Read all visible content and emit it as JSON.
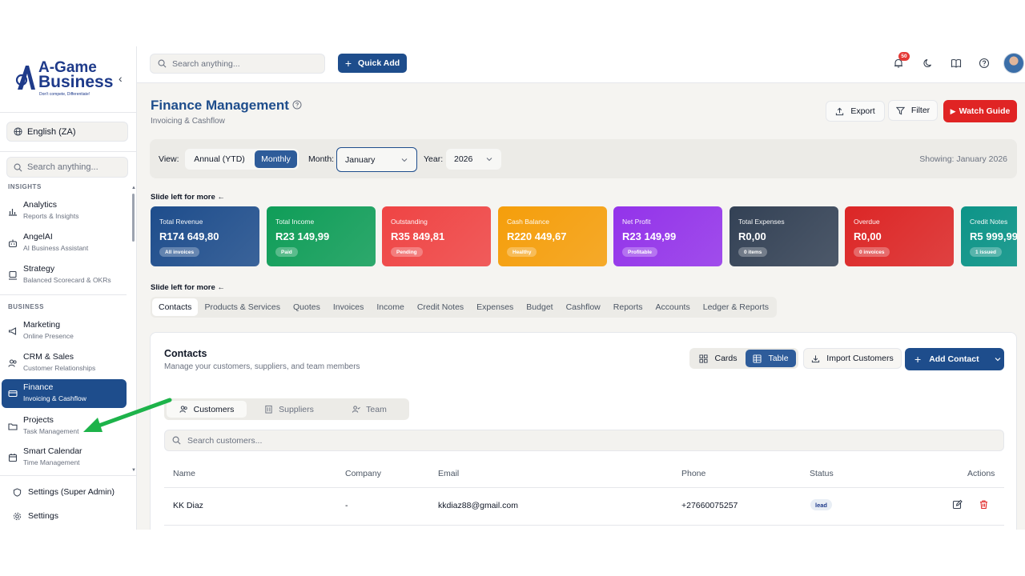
{
  "brand": {
    "line1": "A-Game",
    "line2": "Business",
    "tagline": "Don't compete, Differentiate!"
  },
  "sidebar": {
    "language": "English (ZA)",
    "search_placeholder": "Search anything...",
    "section_insights": "INSIGHTS",
    "section_business": "BUSINESS",
    "items": [
      {
        "title": "Analytics",
        "subtitle": "Reports & Insights",
        "icon": "bar-chart-icon"
      },
      {
        "title": "AngelAI",
        "subtitle": "AI Business Assistant",
        "icon": "robot-icon"
      },
      {
        "title": "Strategy",
        "subtitle": "Balanced Scorecard & OKRs",
        "icon": "strategy-icon"
      },
      {
        "title": "Marketing",
        "subtitle": "Online Presence",
        "icon": "megaphone-icon"
      },
      {
        "title": "CRM & Sales",
        "subtitle": "Customer Relationships",
        "icon": "users-icon"
      },
      {
        "title": "Finance",
        "subtitle": "Invoicing & Cashflow",
        "icon": "credit-card-icon"
      },
      {
        "title": "Projects",
        "subtitle": "Task Management",
        "icon": "folder-icon"
      },
      {
        "title": "Smart Calendar",
        "subtitle": "Time Management",
        "icon": "calendar-icon"
      }
    ],
    "bottom": [
      {
        "label": "Settings (Super Admin)",
        "icon": "shield-icon"
      },
      {
        "label": "Settings",
        "icon": "gear-icon"
      }
    ]
  },
  "topbar": {
    "search_placeholder": "Search anything...",
    "quick_add": "Quick Add",
    "notification_count": "50"
  },
  "page": {
    "title": "Finance Management",
    "subtitle": "Invoicing & Cashflow",
    "export": "Export",
    "filter": "Filter",
    "watch_guide": "Watch Guide"
  },
  "filters": {
    "view_label": "View:",
    "view_options": [
      "Annual (YTD)",
      "Monthly"
    ],
    "view_selected": "Monthly",
    "month_label": "Month:",
    "month": "January",
    "year_label": "Year:",
    "year": "2026",
    "showing": "Showing: January 2026"
  },
  "slide_hint": "Slide left for more ←",
  "cards": [
    {
      "label": "Total Revenue",
      "value": "R174 649,80",
      "pill": "All invoices",
      "color": "#1e4d8c"
    },
    {
      "label": "Total Income",
      "value": "R23 149,99",
      "pill": "Paid",
      "color": "#0f9d58"
    },
    {
      "label": "Outstanding",
      "value": "R35 849,81",
      "pill": "Pending",
      "color": "#ef4444"
    },
    {
      "label": "Cash Balance",
      "value": "R220 449,67",
      "pill": "Healthy",
      "color": "#f59e0b"
    },
    {
      "label": "Net Profit",
      "value": "R23 149,99",
      "pill": "Profitable",
      "color": "#9333ea"
    },
    {
      "label": "Total Expenses",
      "value": "R0,00",
      "pill": "0 items",
      "color": "#334155"
    },
    {
      "label": "Overdue",
      "value": "R0,00",
      "pill": "0 invoices",
      "color": "#dc2626"
    },
    {
      "label": "Credit Notes",
      "value": "R5 999,99",
      "pill": "1 issued",
      "color": "#0d9488"
    }
  ],
  "tabs": [
    "Contacts",
    "Products & Services",
    "Quotes",
    "Invoices",
    "Income",
    "Credit Notes",
    "Expenses",
    "Budget",
    "Cashflow",
    "Reports",
    "Accounts",
    "Ledger & Reports"
  ],
  "contacts": {
    "title": "Contacts",
    "subtitle": "Manage your customers, suppliers, and team members",
    "view_cards": "Cards",
    "view_table": "Table",
    "import": "Import Customers",
    "add": "Add Contact",
    "subtabs": [
      "Customers",
      "Suppliers",
      "Team"
    ],
    "search_placeholder": "Search customers...",
    "columns": [
      "Name",
      "Company",
      "Email",
      "Phone",
      "Status",
      "Actions"
    ],
    "rows": [
      {
        "name": "KK Diaz",
        "company": "-",
        "email": "kkdiaz88@gmail.com",
        "phone": "+27660075257",
        "status": "lead"
      }
    ]
  }
}
